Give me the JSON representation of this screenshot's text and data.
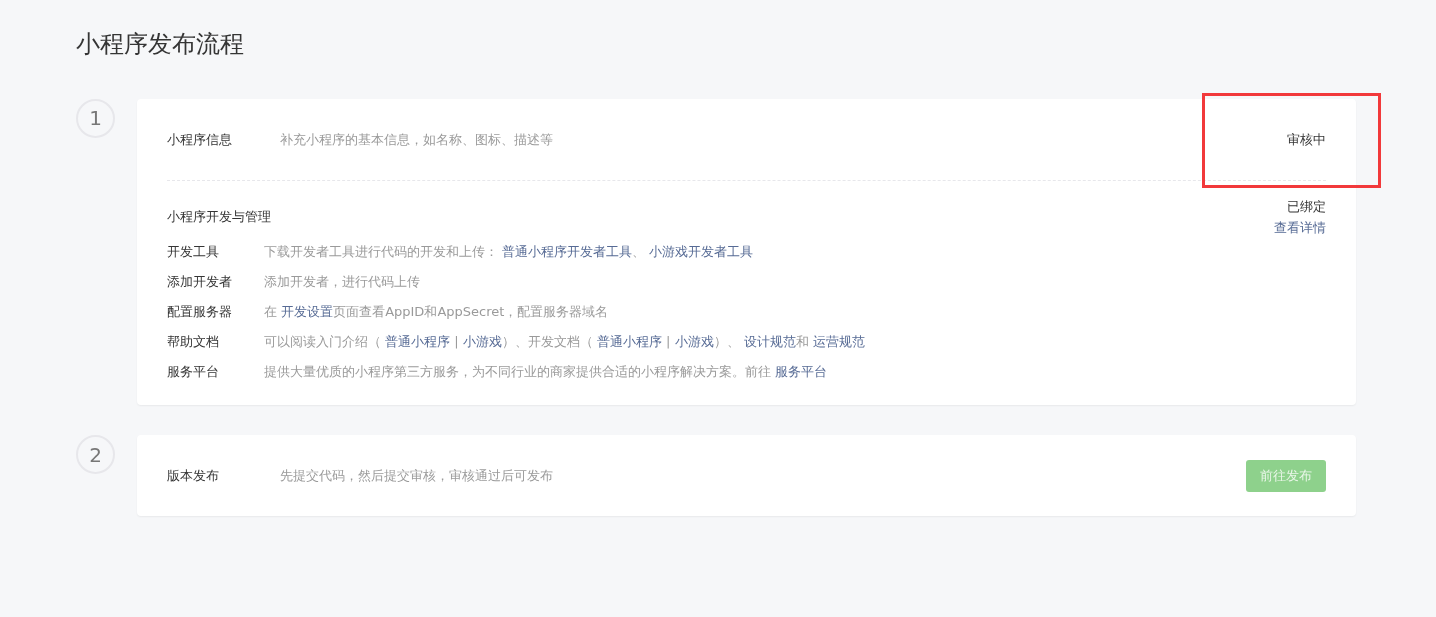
{
  "title": "小程序发布流程",
  "steps": [
    {
      "number": "1",
      "sections": [
        {
          "kind": "summary",
          "label": "小程序信息",
          "description": "补充小程序的基本信息，如名称、图标、描述等",
          "status": "审核中",
          "highlighted": true
        },
        {
          "kind": "details",
          "label": "小程序开发与管理",
          "status": "已绑定",
          "link": "查看详情",
          "rows": [
            {
              "label": "开发工具",
              "parts": [
                {
                  "kind": "text",
                  "text": "下载开发者工具进行代码的开发和上传： "
                },
                {
                  "kind": "link",
                  "text": "普通小程序开发者工具"
                },
                {
                  "kind": "text",
                  "text": "、 "
                },
                {
                  "kind": "link",
                  "text": "小游戏开发者工具"
                }
              ]
            },
            {
              "label": "添加开发者",
              "parts": [
                {
                  "kind": "text",
                  "text": "添加开发者，进行代码上传"
                }
              ]
            },
            {
              "label": "配置服务器",
              "parts": [
                {
                  "kind": "text",
                  "text": "在 "
                },
                {
                  "kind": "link",
                  "text": "开发设置"
                },
                {
                  "kind": "text",
                  "text": "页面查看AppID和AppSecret，配置服务器域名"
                }
              ]
            },
            {
              "label": "帮助文档",
              "parts": [
                {
                  "kind": "text",
                  "text": "可以阅读入门介绍（ "
                },
                {
                  "kind": "link",
                  "text": "普通小程序"
                },
                {
                  "kind": "text",
                  "text": " | "
                },
                {
                  "kind": "link",
                  "text": "小游戏"
                },
                {
                  "kind": "text",
                  "text": "）、开发文档（ "
                },
                {
                  "kind": "link",
                  "text": "普通小程序"
                },
                {
                  "kind": "text",
                  "text": " | "
                },
                {
                  "kind": "link",
                  "text": "小游戏"
                },
                {
                  "kind": "text",
                  "text": "）、 "
                },
                {
                  "kind": "link",
                  "text": "设计规范"
                },
                {
                  "kind": "text",
                  "text": "和 "
                },
                {
                  "kind": "link",
                  "text": "运营规范"
                }
              ]
            },
            {
              "label": "服务平台",
              "parts": [
                {
                  "kind": "text",
                  "text": "提供大量优质的小程序第三方服务，为不同行业的商家提供合适的小程序解决方案。前往 "
                },
                {
                  "kind": "link",
                  "text": "服务平台"
                }
              ]
            }
          ]
        }
      ]
    },
    {
      "number": "2",
      "sections": [
        {
          "kind": "action",
          "label": "版本发布",
          "description": "先提交代码，然后提交审核，审核通过后可发布",
          "button": {
            "label": "前往发布",
            "disabled": true
          }
        }
      ]
    }
  ]
}
